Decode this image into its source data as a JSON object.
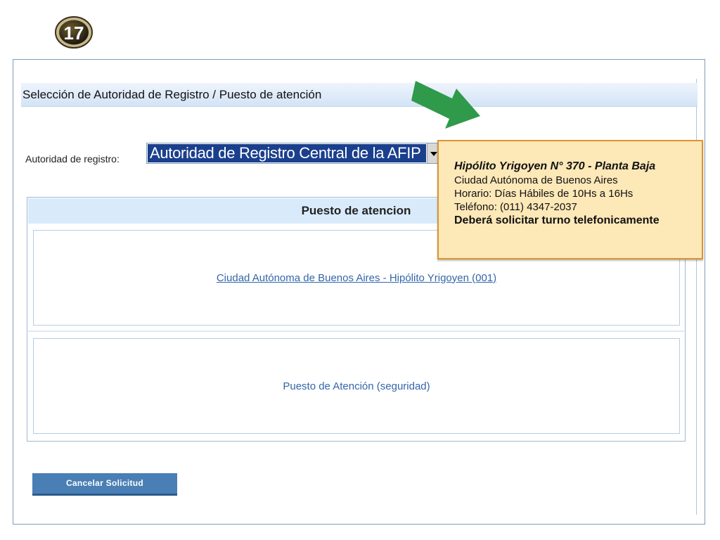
{
  "step_badge": {
    "number": "17"
  },
  "section": {
    "title": "Selección de Autoridad de Registro / Puesto de atención"
  },
  "registro": {
    "label": "Autoridad de registro:",
    "selected_value": "Autoridad de Registro Central de la AFIP"
  },
  "table": {
    "header": "Puesto de atencion",
    "rows": [
      {
        "label": "Ciudad Autónoma de Buenos Aires - Hipólito Yrigoyen (001)",
        "is_link": true
      },
      {
        "label": "Puesto de Atención (seguridad)",
        "is_link": false
      }
    ]
  },
  "tooltip": {
    "title": "Hipólito Yrigoyen N° 370 - Planta Baja",
    "lines": [
      "Ciudad Autónoma de Buenos Aires",
      "Horario: Días Hábiles de 10Hs a 16Hs",
      "Teléfono: (011) 4347-2037"
    ],
    "note": "Deberá solicitar turno telefonicamente"
  },
  "actions": {
    "cancel_label": "Cancelar Solicitud"
  },
  "colors": {
    "select_highlight": "#1a3f8c",
    "header_bg": "#d9ebfb",
    "link": "#3366aa",
    "tooltip_bg": "#fde8b8",
    "tooltip_border": "#d99530",
    "arrow": "#2e9a4a",
    "button": "#4a7fb5"
  },
  "icons": {
    "step": "numbered-circle-icon",
    "pointer": "green-arrow-icon",
    "dropdown": "chevron-down-icon"
  }
}
